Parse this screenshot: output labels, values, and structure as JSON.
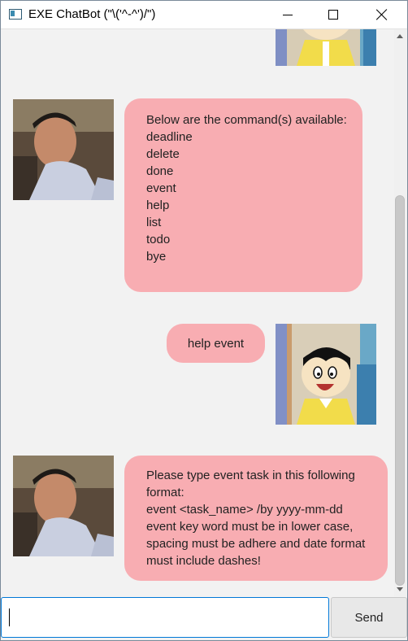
{
  "window": {
    "title": "EXE ChatBot (\"\\('^-^')/\")"
  },
  "conversation": {
    "message_1": {
      "sender": "bot",
      "lines": [
        "Below are the command(s) available:",
        "deadline",
        "delete",
        "done",
        "event",
        "help",
        "list",
        "todo",
        "bye"
      ]
    },
    "message_2": {
      "sender": "user",
      "text": "help event"
    },
    "message_3": {
      "sender": "bot",
      "lines": [
        "Please type event task in this following",
        "format:",
        "event <task_name> /by yyyy-mm-dd",
        "event key word must be in lower case,",
        "spacing must be adhere and date format",
        "must include dashes!"
      ]
    }
  },
  "input": {
    "value": "",
    "send_label": "Send"
  },
  "colors": {
    "bubble": "#f8adb2",
    "background": "#f2f2f2",
    "input_border": "#0078d7"
  }
}
